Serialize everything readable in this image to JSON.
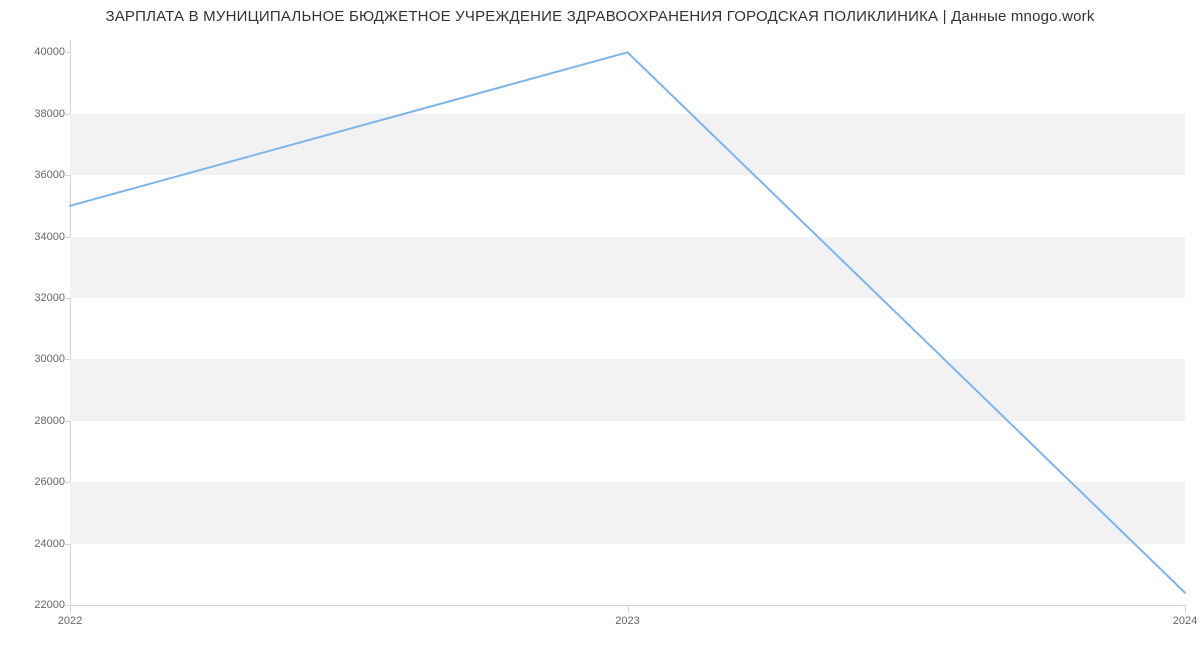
{
  "chart_data": {
    "type": "line",
    "title": "ЗАРПЛАТА В МУНИЦИПАЛЬНОЕ БЮДЖЕТНОЕ УЧРЕЖДЕНИЕ ЗДРАВООХРАНЕНИЯ ГОРОДСКАЯ ПОЛИКЛИНИКА | Данные mnogo.work",
    "xlabel": "",
    "ylabel": "",
    "x": [
      2022,
      2023,
      2024
    ],
    "values": [
      35000,
      40000,
      22400
    ],
    "yticks": [
      22000,
      24000,
      26000,
      28000,
      30000,
      32000,
      34000,
      36000,
      38000,
      40000
    ],
    "xticks": [
      2022,
      2023,
      2024
    ],
    "ylim": [
      22000,
      40400
    ],
    "xlim": [
      2022,
      2024
    ],
    "line_color": "#7cb5ec",
    "band_color": "#f2f2f2"
  }
}
